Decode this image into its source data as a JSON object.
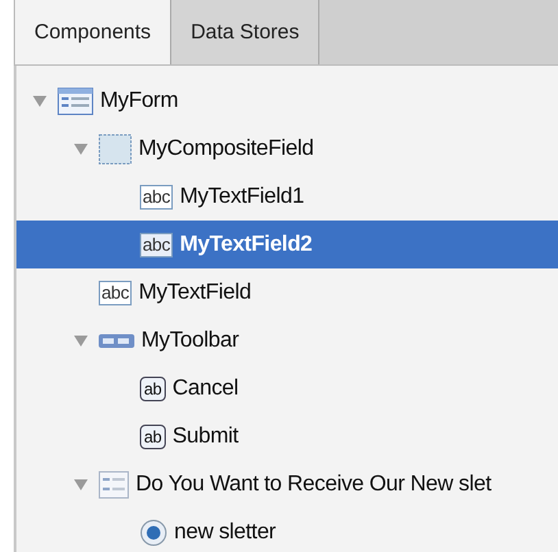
{
  "tabs": [
    {
      "label": "Components",
      "selected": true
    },
    {
      "label": "Data Stores",
      "selected": false
    }
  ],
  "tree": [
    {
      "label": "MyForm",
      "kind": "form",
      "expanded": true,
      "selected": false,
      "children": [
        {
          "label": "MyCompositeField",
          "kind": "composite",
          "expanded": true,
          "selected": false,
          "children": [
            {
              "label": "MyTextField1",
              "kind": "textfield",
              "icon_text": "abc",
              "selected": false
            },
            {
              "label": "MyTextField2",
              "kind": "textfield",
              "icon_text": "abc",
              "selected": true
            }
          ]
        },
        {
          "label": "MyTextField",
          "kind": "textfield",
          "icon_text": "abc",
          "selected": false
        },
        {
          "label": "MyToolbar",
          "kind": "toolbar",
          "expanded": true,
          "selected": false,
          "children": [
            {
              "label": "Cancel",
              "kind": "button",
              "icon_text": "ab",
              "selected": false
            },
            {
              "label": "Submit",
              "kind": "button",
              "icon_text": "ab",
              "selected": false
            }
          ]
        },
        {
          "label": "Do You Want to Receive Our New slet",
          "kind": "radiogroup",
          "expanded": true,
          "selected": false,
          "children": [
            {
              "label": "new sletter",
              "kind": "radio",
              "selected": false
            }
          ]
        }
      ]
    }
  ]
}
